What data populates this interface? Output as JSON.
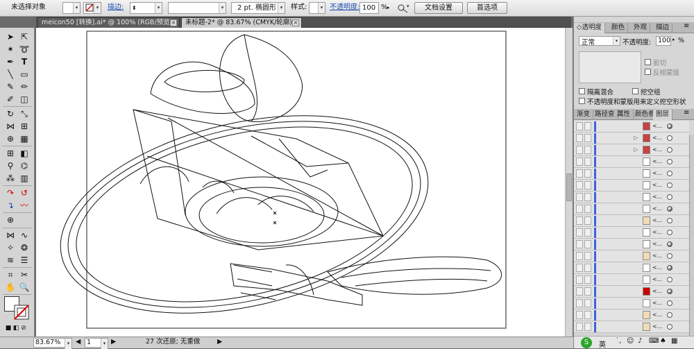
{
  "control_bar": {
    "selection_label": "未选择对象",
    "stroke_label": "描边:",
    "stroke_weight": "",
    "brush_value": "2 pt. 椭圆形",
    "style_label": "样式:",
    "opacity_label": "不透明度:",
    "opacity_value": "100",
    "opacity_unit": "%",
    "doc_setup_button": "文档设置",
    "prefs_button": "首选项"
  },
  "tabs": [
    {
      "label": "meicon50 [转换].ai* @ 100% (RGB/预览)",
      "active": false
    },
    {
      "label": "未标题-2* @ 83.67% (CMYK/轮廓)",
      "active": true
    }
  ],
  "status_bar": {
    "zoom": "83.67%",
    "page": "1",
    "undo_text": "27 次还原; 无重做"
  },
  "transparency_panel": {
    "tabs": [
      "透明度",
      "颜色",
      "外观",
      "描边"
    ],
    "blend_mode": "正常",
    "opacity_label": "不透明度:",
    "opacity_value": "100",
    "opacity_unit": "%",
    "clip_label": "剪切",
    "invert_mask_label": "反相蒙版",
    "isolate_blend_label": "隔离混合",
    "knockout_group_label": "挖空组",
    "opacity_mask_label": "不透明度和蒙版用来定义挖空形状"
  },
  "layers_panel": {
    "tabs": [
      "渐变",
      "路径查",
      "属性",
      "颜色参",
      "图层"
    ],
    "rows": [
      {
        "name": "<...",
        "thumb_color": "#c94040",
        "expand": false,
        "target_filled": true
      },
      {
        "name": "<...",
        "thumb_color": "#c94040",
        "expand": true,
        "target_filled": false
      },
      {
        "name": "<...",
        "thumb_color": "#c94040",
        "expand": true,
        "target_filled": false
      },
      {
        "name": "<...",
        "thumb_color": "#ffffff",
        "expand": false,
        "target_filled": false
      },
      {
        "name": "<...",
        "thumb_color": "#ffffff",
        "expand": false,
        "target_filled": false
      },
      {
        "name": "<...",
        "thumb_color": "#ffffff",
        "expand": false,
        "target_filled": false
      },
      {
        "name": "<...",
        "thumb_color": "#ffffff",
        "expand": false,
        "target_filled": false
      },
      {
        "name": "<...",
        "thumb_color": "#ffffff",
        "expand": false,
        "target_filled": true
      },
      {
        "name": "<...",
        "thumb_color": "#f2dcb5",
        "expand": false,
        "target_filled": false
      },
      {
        "name": "<...",
        "thumb_color": "#ffffff",
        "expand": false,
        "target_filled": false
      },
      {
        "name": "<...",
        "thumb_color": "#ffffff",
        "expand": false,
        "target_filled": true
      },
      {
        "name": "<...",
        "thumb_color": "#f2dcb5",
        "expand": false,
        "target_filled": false
      },
      {
        "name": "<...",
        "thumb_color": "#ffffff",
        "expand": false,
        "target_filled": true
      },
      {
        "name": "<...",
        "thumb_color": "#ffffff",
        "expand": false,
        "target_filled": false
      },
      {
        "name": "<...",
        "thumb_color": "#cc0000",
        "expand": false,
        "target_filled": true
      },
      {
        "name": "<...",
        "thumb_color": "#ffffff",
        "expand": false,
        "target_filled": false
      },
      {
        "name": "<...",
        "thumb_color": "#f2dcb5",
        "expand": false,
        "target_filled": false
      },
      {
        "name": "<...",
        "thumb_color": "#f2dcb5",
        "expand": false,
        "target_filled": false
      }
    ]
  },
  "taskbar": {
    "ime_label": "英"
  },
  "colors": {
    "accent": "#3d63d6",
    "link": "#1f4fb0"
  }
}
